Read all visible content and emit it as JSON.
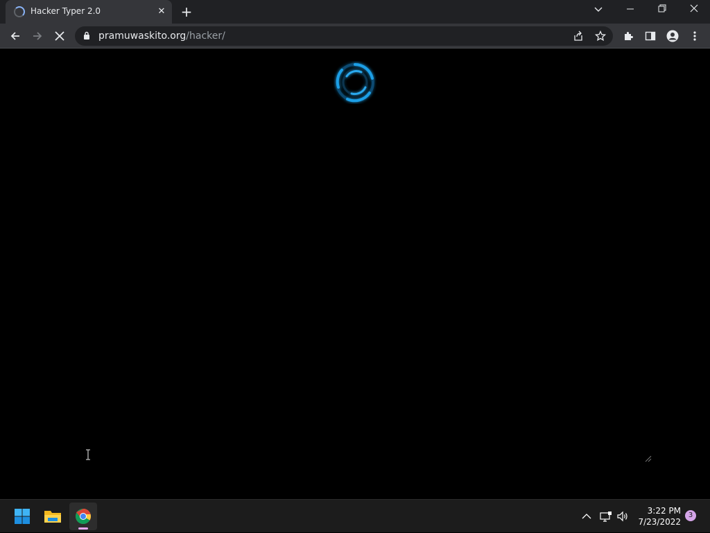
{
  "browser": {
    "tab_title": "Hacker Typer 2.0",
    "url_domain": "pramuwaskito.org",
    "url_path": "/hacker/",
    "accent": "#8ab4f8"
  },
  "page": {
    "loader_color": "#1e9fe6"
  },
  "taskbar": {
    "apps": [
      "windows-start-icon",
      "file-explorer-icon",
      "chrome-icon"
    ],
    "time": "3:22 PM",
    "date": "7/23/2022",
    "notification_count": "3"
  }
}
